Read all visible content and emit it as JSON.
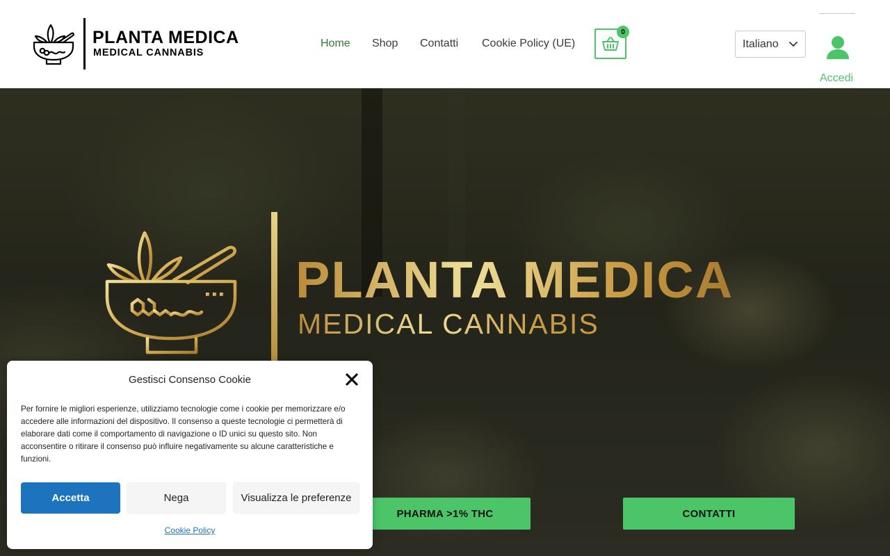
{
  "header": {
    "logo": {
      "title": "PLANTA MEDICA",
      "subtitle": "MEDICAL CANNABIS",
      "icon": "mortar-pestle-leaf-icon"
    },
    "nav": [
      {
        "label": "Home",
        "active": true
      },
      {
        "label": "Shop",
        "active": false
      },
      {
        "label": "Contatti",
        "active": false
      },
      {
        "label": "Cookie Policy (UE)",
        "active": false
      }
    ],
    "cart": {
      "icon": "basket-icon",
      "count": "0"
    },
    "language": {
      "selected": "Italiano",
      "icon": "chevron-down-icon"
    },
    "account": {
      "label": "Accedi",
      "icon": "user-icon"
    }
  },
  "hero": {
    "logo": {
      "title": "PLANTA MEDICA",
      "subtitle": "MEDICAL CANNABIS",
      "icon": "mortar-pestle-leaf-icon"
    },
    "buttons": {
      "pharma": "PHARMA >1% THC",
      "contatti": "CONTATTI"
    }
  },
  "cookie_dialog": {
    "title": "Gestisci Consenso Cookie",
    "text": "Per fornire le migliori esperienze, utilizziamo tecnologie come i cookie per memorizzare e/o accedere alle informazioni del dispositivo. Il consenso a queste tecnologie ci permetterà di elaborare dati come il comportamento di navigazione o ID unici su questo sito. Non acconsentire o ritirare il consenso può influire negativamente su alcune caratteristiche e funzioni.",
    "buttons": {
      "accept": "Accetta",
      "deny": "Nega",
      "preferences": "Visualizza le preferenze"
    },
    "link": "Cookie Policy",
    "close_icon": "close-icon"
  },
  "colors": {
    "accent_green": "#4cc569",
    "nav_active": "#2e7d32",
    "accept_blue": "#1e73be",
    "gold": "#d9b65a"
  }
}
